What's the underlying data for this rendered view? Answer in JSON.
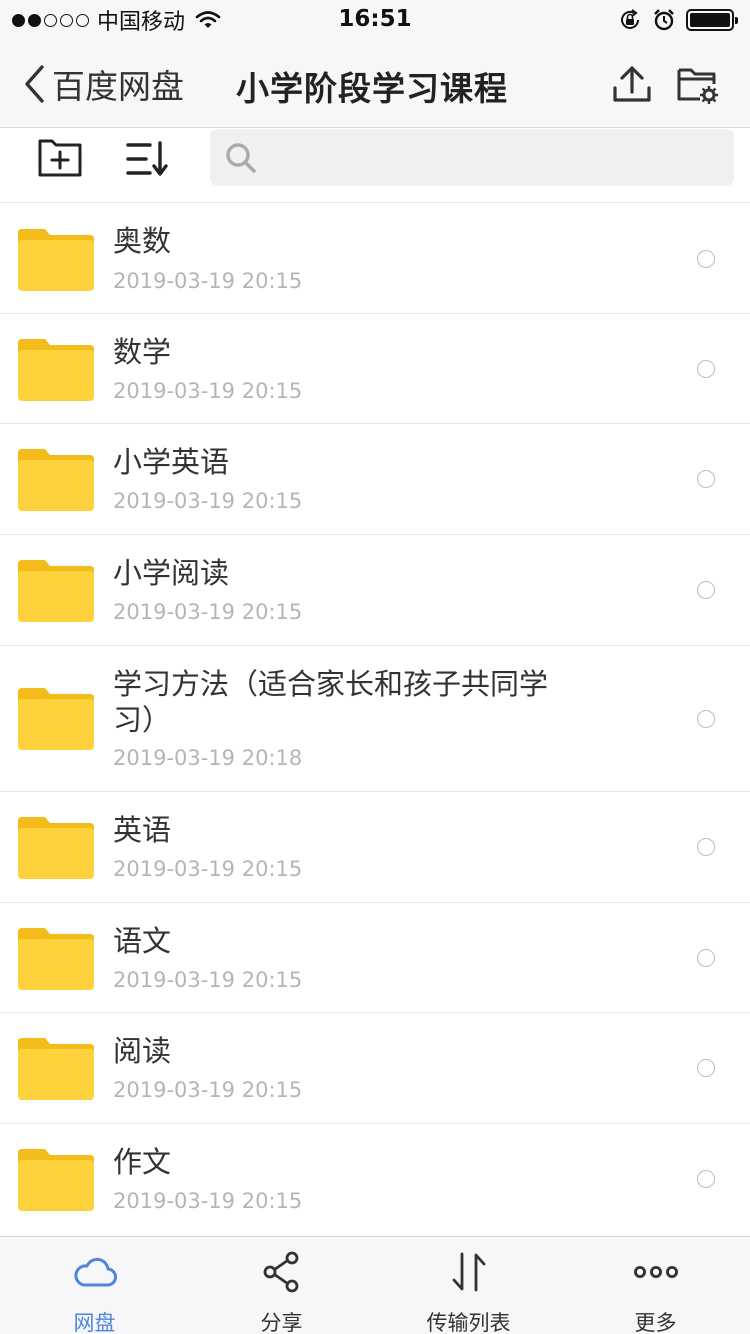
{
  "status_bar": {
    "carrier": "中国移动",
    "time": "16:51",
    "icons": [
      "signal-dots",
      "wifi-icon",
      "rotation-lock-icon",
      "alarm-icon",
      "battery-icon"
    ]
  },
  "nav": {
    "back_label": "百度网盘",
    "title": "小学阶段学习课程",
    "icons": [
      "chevron-left-icon",
      "upload-icon",
      "folder-settings-icon"
    ]
  },
  "toolbar": {
    "icons": [
      "new-folder-icon",
      "sort-icon",
      "search-icon"
    ],
    "search_placeholder": ""
  },
  "files": [
    {
      "name": "奥数",
      "date": "2019-03-19 20:15"
    },
    {
      "name": "数学",
      "date": "2019-03-19 20:15"
    },
    {
      "name": "小学英语",
      "date": "2019-03-19 20:15"
    },
    {
      "name": "小学阅读",
      "date": "2019-03-19 20:15"
    },
    {
      "name": "学习方法（适合家长和孩子共同学习）",
      "date": "2019-03-19 20:18"
    },
    {
      "name": "英语",
      "date": "2019-03-19 20:15"
    },
    {
      "name": "语文",
      "date": "2019-03-19 20:15"
    },
    {
      "name": "阅读",
      "date": "2019-03-19 20:15"
    },
    {
      "name": "作文",
      "date": "2019-03-19 20:15"
    }
  ],
  "tabs": [
    {
      "label": "网盘",
      "icon": "cloud-icon",
      "active": true
    },
    {
      "label": "分享",
      "icon": "share-icon",
      "active": false
    },
    {
      "label": "传输列表",
      "icon": "transfer-icon",
      "active": false
    },
    {
      "label": "更多",
      "icon": "more-icon",
      "active": false
    }
  ],
  "colors": {
    "accent": "#4d87db",
    "folder": "#fdd23c",
    "folder_tab": "#f2bd1b",
    "date_text": "#b5b5b5",
    "bar_background": "#f7f7f9"
  }
}
